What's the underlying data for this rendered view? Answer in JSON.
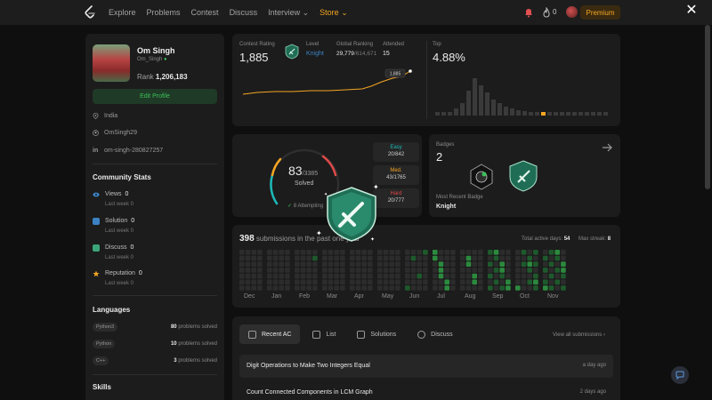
{
  "nav": {
    "links": [
      "Explore",
      "Problems",
      "Contest",
      "Discuss",
      "Interview",
      "Store"
    ],
    "fire_count": "0",
    "premium_label": "Premium"
  },
  "profile": {
    "name": "Om Singh",
    "handle": "Om_Singh",
    "rank_label": "Rank",
    "rank_value": "1,206,183",
    "edit_label": "Edit Profile",
    "location": "India",
    "github": "OmSingh29",
    "linkedin": "om-singh-280827257"
  },
  "community": {
    "title": "Community Stats",
    "items": [
      {
        "label": "Views",
        "value": "0",
        "sub": "Last week 0",
        "color": "#3b82c4"
      },
      {
        "label": "Solution",
        "value": "0",
        "sub": "Last week 0",
        "color": "#3b82c4"
      },
      {
        "label": "Discuss",
        "value": "0",
        "sub": "Last week 0",
        "color": "#3aa57a"
      },
      {
        "label": "Reputation",
        "value": "0",
        "sub": "Last week 0",
        "color": "#f5a623"
      }
    ]
  },
  "languages": {
    "title": "Languages",
    "items": [
      {
        "name": "Python3",
        "count": "80",
        "suffix": "problems solved"
      },
      {
        "name": "Python",
        "count": "10",
        "suffix": "problems solved"
      },
      {
        "name": "C++",
        "count": "3",
        "suffix": "problems solved"
      }
    ]
  },
  "skills_title": "Skills",
  "rating": {
    "contest_rating_label": "Contest Rating",
    "contest_rating": "1,885",
    "level_label": "Level",
    "level": "Knight",
    "global_label": "Global Ranking",
    "global_rank": "29,779",
    "global_total": "/614,671",
    "attended_label": "Attended",
    "attended": "15",
    "chart_tag": "1,885",
    "top_label": "Top",
    "top_value": "4.88%"
  },
  "solved": {
    "count": "83",
    "total": "/3385",
    "label": "Solved",
    "attempting": "8 Attempting",
    "easy_label": "Easy",
    "easy": "20/842",
    "medium_label": "Med.",
    "medium": "43/1765",
    "hard_label": "Hard",
    "hard": "20/777"
  },
  "badges": {
    "label": "Badges",
    "count": "2",
    "recent_label": "Most Recent Badge",
    "recent": "Knight"
  },
  "submissions": {
    "count": "398",
    "text": "submissions in the past one year",
    "active_label": "Total active days:",
    "active": "54",
    "streak_label": "Max streak:",
    "streak": "8",
    "months": [
      "Dec",
      "Jan",
      "Feb",
      "Mar",
      "Apr",
      "May",
      "Jun",
      "Jul",
      "Aug",
      "Sep",
      "Oct",
      "Nov"
    ]
  },
  "recent": {
    "tabs": [
      "Recent AC",
      "List",
      "Solutions",
      "Discuss"
    ],
    "view_all": "View all submissions",
    "items": [
      {
        "title": "Digit Operations to Make Two Integers Equal",
        "date": "a day ago"
      },
      {
        "title": "Count Connected Components in LCM Graph",
        "date": "2 days ago"
      }
    ]
  }
}
